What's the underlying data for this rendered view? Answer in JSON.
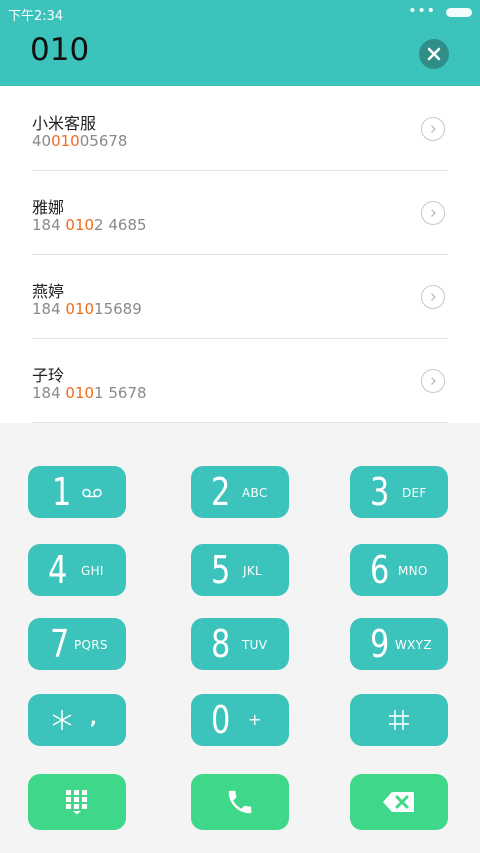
{
  "status_bar": {
    "time": "下午2:34",
    "dots": "•••"
  },
  "header": {
    "dialed_number": "010"
  },
  "results": [
    {
      "name": "小米客服",
      "number_prefix": "40",
      "number_match": "010",
      "number_suffix": "05678"
    },
    {
      "name": "雅娜",
      "number_prefix": "184 ",
      "number_match": "010",
      "number_suffix": "2 4685"
    },
    {
      "name": "燕婷",
      "number_prefix": "184 ",
      "number_match": "010",
      "number_suffix": "15689"
    },
    {
      "name": "子玲",
      "number_prefix": "184 ",
      "number_match": "010",
      "number_suffix": "1 5678"
    }
  ],
  "keypad": {
    "k1": {
      "digit": "1",
      "letters": ""
    },
    "k2": {
      "digit": "2",
      "letters": "ABC"
    },
    "k3": {
      "digit": "3",
      "letters": "DEF"
    },
    "k4": {
      "digit": "4",
      "letters": "GHI"
    },
    "k5": {
      "digit": "5",
      "letters": "JKL"
    },
    "k6": {
      "digit": "6",
      "letters": "MNO"
    },
    "k7": {
      "digit": "7",
      "letters": "PQRS"
    },
    "k8": {
      "digit": "8",
      "letters": "TUV"
    },
    "k9": {
      "digit": "9",
      "letters": "WXYZ"
    },
    "kstar": {
      "digit": "*",
      "letters": ","
    },
    "k0": {
      "digit": "0",
      "letters": "+"
    },
    "khash": {
      "digit": "#",
      "letters": ""
    }
  },
  "colors": {
    "accent": "#3bc3bc",
    "call_green": "#3fd78a",
    "highlight": "#f06a1b"
  },
  "icons": [
    "voicemail-icon",
    "clear-icon",
    "detail-chevron-icon",
    "dialpad-toggle-icon",
    "phone-icon",
    "backspace-icon"
  ]
}
